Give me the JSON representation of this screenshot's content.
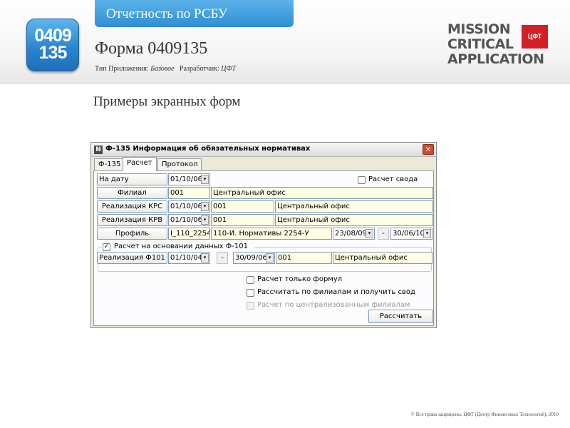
{
  "header": {
    "top_tab": "Отчетность по РСБУ",
    "icon_line1": "0409",
    "icon_line2": "135",
    "form_title": "Форма 0409135",
    "meta": {
      "type_label": "Тип Приложения:",
      "type_value": "Базовое",
      "dev_label": "Разработчик:",
      "dev_value": "ЦФТ"
    },
    "mca_lines": [
      "MISSION",
      "CRITICAL",
      "APPLICATION"
    ],
    "mca_logo": "ЦФТ"
  },
  "section_title": "Примеры экранных форм",
  "window": {
    "title": "Ф-135 Информация об обязательных нормативах",
    "title_icon": "N",
    "close_glyph": "✕",
    "tabs": [
      "Ф-135",
      "Расчет",
      "Протокол"
    ],
    "active_tab": "Расчет",
    "rows": {
      "na_datu": {
        "label": "На дату",
        "date": "01/10/06"
      },
      "svod": {
        "label": "Расчет свода",
        "checked": false
      },
      "filial": {
        "button": "Филиал",
        "code": "001",
        "name": "Центральный офис"
      },
      "krs": {
        "button": "Реализация КРС",
        "date": "01/10/06",
        "code": "001",
        "name": "Центральный офис"
      },
      "krv": {
        "button": "Реализация КРВ",
        "date": "01/10/06",
        "code": "001",
        "name": "Центральный офис"
      },
      "profil": {
        "button": "Профиль",
        "code": "I_110_2254",
        "name": "110-И. Нормативы 2254-У",
        "date_from": "23/08/09",
        "dash": "-",
        "date_to": "30/06/10"
      },
      "group": {
        "label": "Расчет на основании данных Ф-101",
        "checked": true
      },
      "f101": {
        "button": "Реализация Ф101",
        "date_from": "01/10/04",
        "dash": "-",
        "date_to": "30/09/06",
        "code": "001",
        "name": "Центральный офис"
      }
    },
    "options": [
      {
        "label": "Расчет только формул",
        "checked": false,
        "disabled": false
      },
      {
        "label": "Рассчитать по филиалам и получить свод",
        "checked": false,
        "disabled": false
      },
      {
        "label": "Расчет по централизованным филиалам",
        "checked": false,
        "disabled": true
      }
    ],
    "calc_button": "Рассчитать",
    "dropdown_glyph": "▾",
    "check_glyph": "✓"
  },
  "copyright": "© Все права защищены, ЦФТ (Центр Финансовых Технологий), 2010"
}
